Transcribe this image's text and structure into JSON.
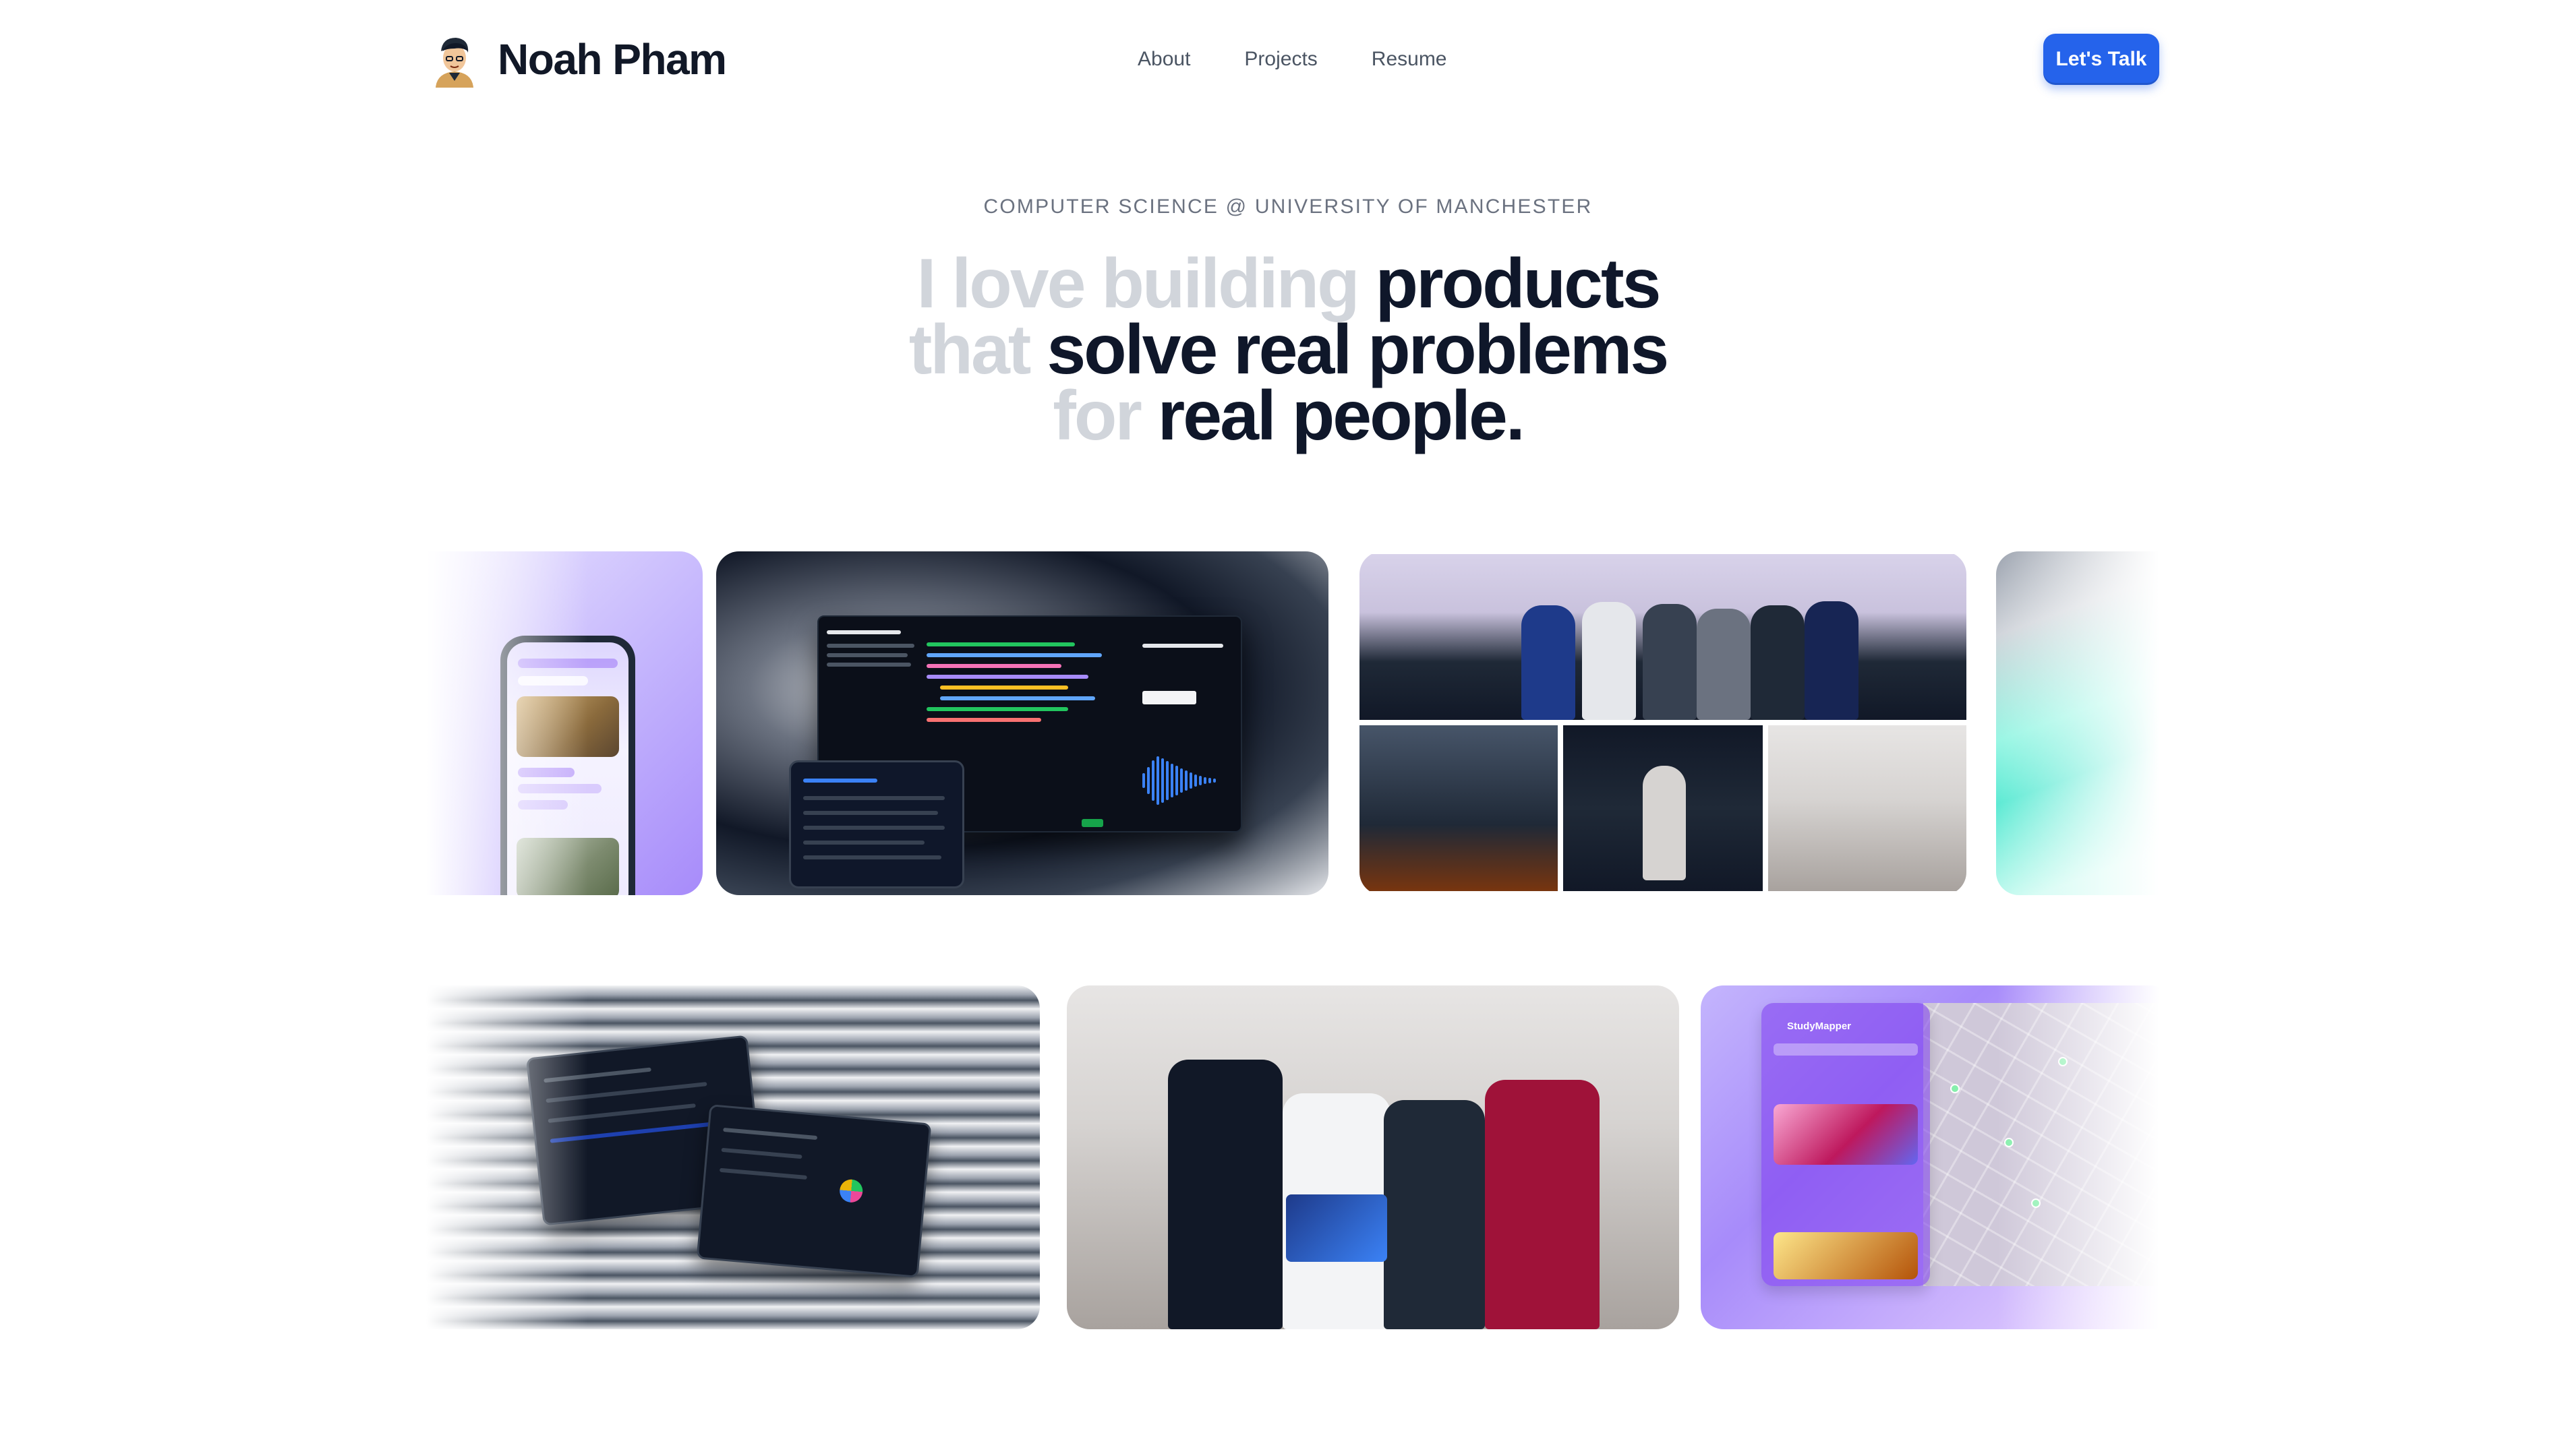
{
  "header": {
    "brand_name": "Noah Pham",
    "nav": [
      {
        "label": "About"
      },
      {
        "label": "Projects"
      },
      {
        "label": "Resume"
      }
    ],
    "cta_label": "Let's Talk"
  },
  "hero": {
    "eyebrow": "COMPUTER SCIENCE @ UNIVERSITY OF MANCHESTER",
    "line1_muted": "I love building",
    "line1_strong": "products",
    "line2_muted": "that",
    "line2_strong": "solve real problems",
    "line3_muted": "for",
    "line3_strong": "real people."
  },
  "gallery": {
    "map_app_title": "StudyMapper"
  },
  "colors": {
    "accent": "#2563eb",
    "headline_strong": "#0f172a",
    "headline_muted": "#d1d5db",
    "eyebrow": "#6b7280"
  }
}
